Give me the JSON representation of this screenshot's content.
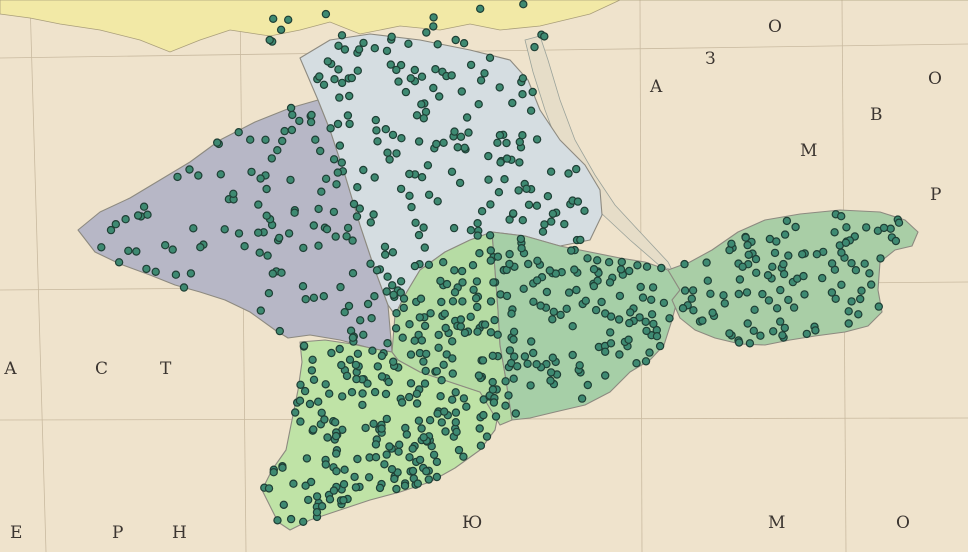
{
  "map": {
    "sea_labels": [
      {
        "name": "azov-sea-letter-a",
        "text": "A"
      },
      {
        "name": "azov-sea-letter-z",
        "text": "З"
      },
      {
        "name": "azov-sea-letter-o",
        "text": "О"
      },
      {
        "name": "azov-sea-letter-v",
        "text": "В"
      },
      {
        "name": "azov-sea-letter-m",
        "text": "М"
      },
      {
        "name": "azov-sea-letter-o2",
        "text": "О"
      },
      {
        "name": "azov-sea-letter-r",
        "text": "Р"
      },
      {
        "name": "black-sea-letter-a",
        "text": "А"
      },
      {
        "name": "black-sea-letter-s",
        "text": "С"
      },
      {
        "name": "black-sea-letter-t",
        "text": "Т"
      },
      {
        "name": "black-sea-letter-e",
        "text": "Е"
      },
      {
        "name": "black-sea-letter-r",
        "text": "Р"
      },
      {
        "name": "black-sea-letter-n",
        "text": "Н"
      },
      {
        "name": "black-sea-letter-io",
        "text": "Ю"
      },
      {
        "name": "black-sea-letter-m",
        "text": "М"
      },
      {
        "name": "black-sea-letter-o",
        "text": "О"
      }
    ],
    "colors": {
      "sea": "#efe3cc",
      "mainland": "#f2e9a6",
      "region_northwest": "#b7b7c6",
      "region_north": "#d5dde1",
      "region_southwest": "#bfe3a6",
      "region_central": "#b6dca4",
      "region_east_central": "#a6cfa7",
      "region_kerch": "#a9cea6",
      "marker_fill": "#3e8a72",
      "marker_stroke": "#1f3f35"
    },
    "marker_icon": "circle-marker-icon"
  }
}
